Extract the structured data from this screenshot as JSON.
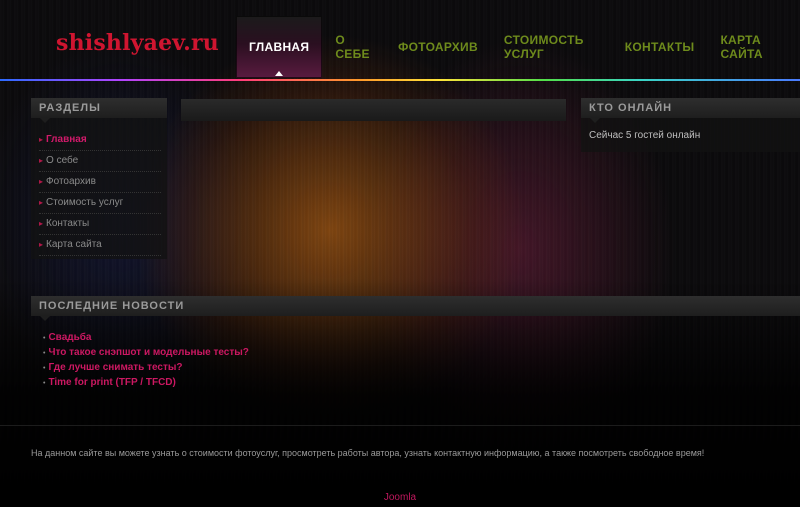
{
  "site": {
    "logo": "shishlyaev.ru"
  },
  "nav": {
    "items": [
      {
        "label": "ГЛАВНАЯ",
        "active": true
      },
      {
        "label": "О СЕБЕ"
      },
      {
        "label": "ФОТОАРХИВ"
      },
      {
        "label": "СТОИМОСТЬ УСЛУГ"
      },
      {
        "label": "КОНТАКТЫ"
      },
      {
        "label": "КАРТА САЙТА"
      }
    ]
  },
  "sections": {
    "title": "РАЗДЕЛЫ",
    "items": [
      {
        "label": "Главная",
        "active": true
      },
      {
        "label": "О себе"
      },
      {
        "label": "Фотоархив"
      },
      {
        "label": "Стоимость услуг"
      },
      {
        "label": "Контакты"
      },
      {
        "label": "Карта сайта"
      }
    ]
  },
  "who_online": {
    "title": "КТО ОНЛАЙН",
    "text": "Сейчас 5 гостей онлайн"
  },
  "news": {
    "title": "ПОСЛЕДНИЕ НОВОСТИ",
    "items": [
      {
        "label": "Свадьба"
      },
      {
        "label": "Что такое снэпшот и модельные тесты?"
      },
      {
        "label": "Где лучше снимать тесты?"
      },
      {
        "label": "Time for print (TFP / TFCD)"
      }
    ]
  },
  "footer": {
    "text": "На данном сайте вы можете узнать о стоимости фотоуслуг, просмотреть работы автора, узнать контактную информацию, а также посмотреть свободное время!",
    "credit": "Joomla"
  },
  "colors": {
    "logo": "#cf1530",
    "nav_text": "#6e8b1c",
    "link_accent": "#cc1862"
  }
}
